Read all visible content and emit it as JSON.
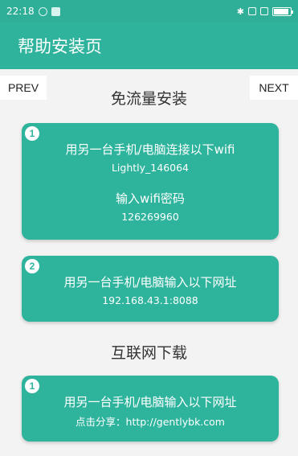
{
  "status_bar": {
    "time": "22:18",
    "battery_level": 0.9
  },
  "app_bar": {
    "title": "帮助安装页"
  },
  "nav": {
    "prev": "PREV",
    "next": "NEXT"
  },
  "section1": {
    "title": "免流量安装",
    "card1": {
      "number": "1",
      "line1": "用另一台手机/电脑连接以下wifi",
      "wifi_name": "Lightly_146064",
      "password_label": "输入wifi密码",
      "password": "126269960"
    },
    "card2": {
      "number": "2",
      "line1": "用另一台手机/电脑输入以下网址",
      "address": "192.168.43.1:8088"
    }
  },
  "section2": {
    "title": "互联网下载",
    "card1": {
      "number": "1",
      "line1": "用另一台手机/电脑输入以下网址",
      "share_text": "点击分享：http://gentlybk.com"
    }
  }
}
